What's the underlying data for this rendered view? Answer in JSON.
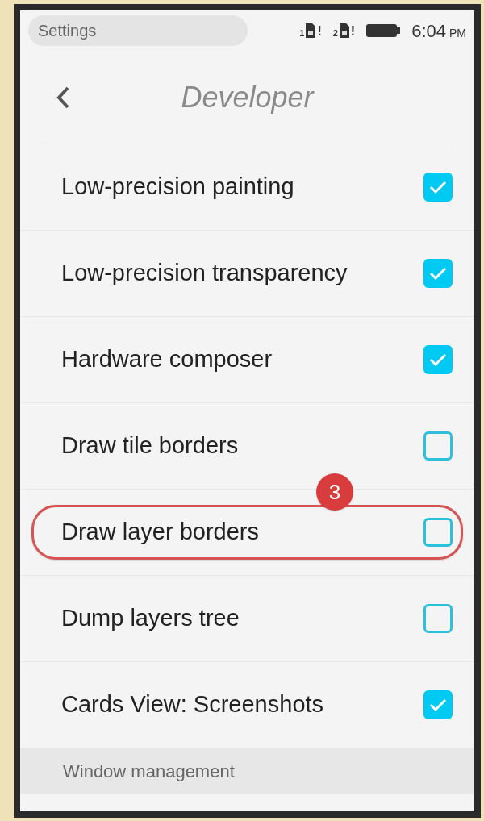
{
  "status_bar": {
    "app_name": "Settings",
    "sim_slots": [
      "1",
      "2"
    ],
    "sim_alert": "!",
    "time": "6:04",
    "meridiem": "PM"
  },
  "header": {
    "title": "Developer"
  },
  "items": [
    {
      "label": "Low-precision painting",
      "checked": true,
      "highlighted": false
    },
    {
      "label": "Low-precision transparency",
      "checked": true,
      "highlighted": false
    },
    {
      "label": "Hardware composer",
      "checked": true,
      "highlighted": false
    },
    {
      "label": "Draw tile borders",
      "checked": false,
      "highlighted": false
    },
    {
      "label": "Draw layer borders",
      "checked": false,
      "highlighted": true,
      "callout": "3"
    },
    {
      "label": "Dump layers tree",
      "checked": false,
      "highlighted": false
    },
    {
      "label": "Cards View: Screenshots",
      "checked": true,
      "highlighted": false
    }
  ],
  "section_header": "Window management"
}
